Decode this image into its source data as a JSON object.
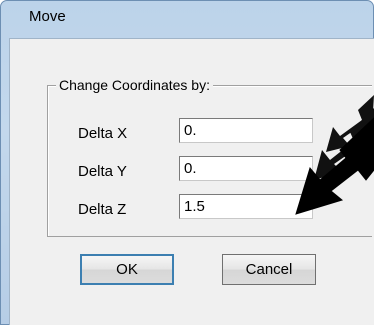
{
  "window": {
    "title": "Move"
  },
  "group": {
    "label": "Change Coordinates by:"
  },
  "fields": [
    {
      "label": "Delta X",
      "value": "0."
    },
    {
      "label": "Delta Y",
      "value": "0."
    },
    {
      "label": "Delta Z",
      "value": "1.5"
    }
  ],
  "buttons": {
    "ok_label": "OK",
    "cancel_label": "Cancel"
  },
  "colors": {
    "frame": "#bcd3ea",
    "client": "#f0f0f0",
    "focus_border": "#3c7fb1",
    "arrow": "#000000"
  }
}
